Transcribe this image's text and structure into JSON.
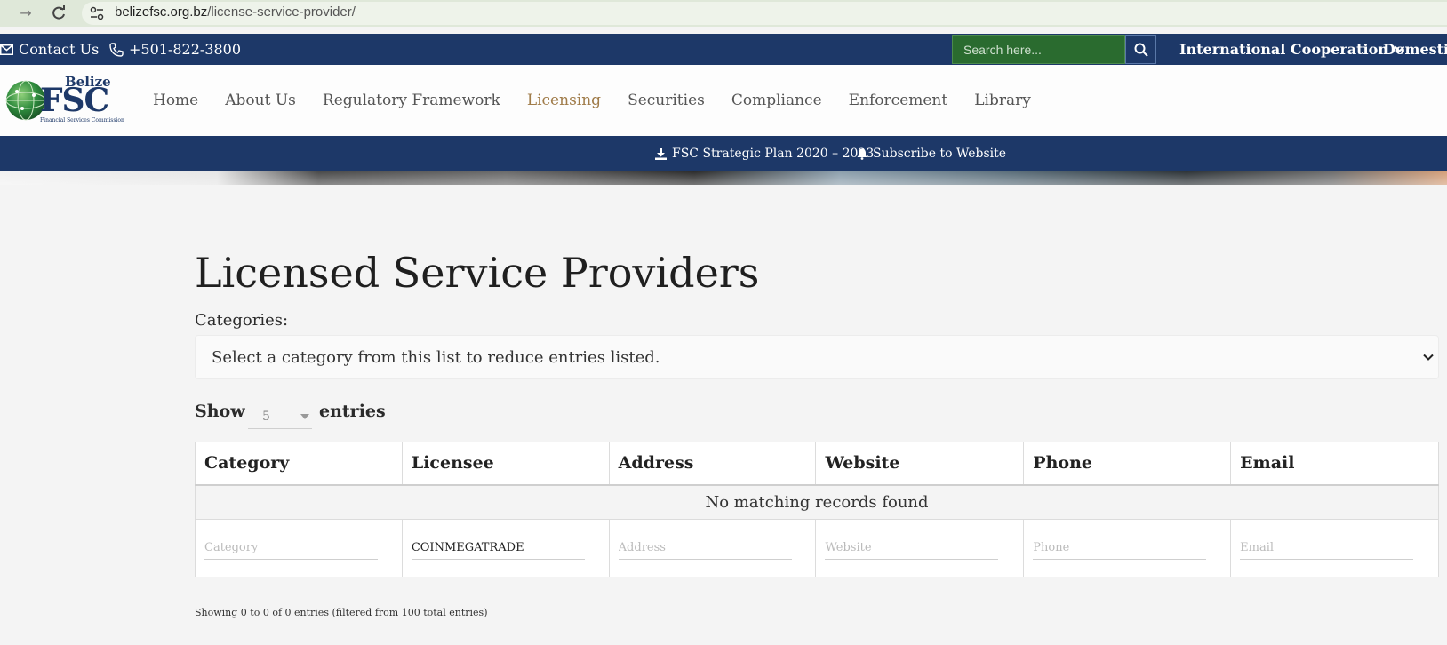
{
  "browser": {
    "url_domain": "belizefsc.org.bz",
    "url_path": "/license-service-provider/"
  },
  "top_bar": {
    "contact_label": "Contact Us",
    "phone_label": "+501-822-3800",
    "search_placeholder": "Search here...",
    "international_label": "International Cooperation",
    "domestic_label": "Domestic C"
  },
  "logo": {
    "top": "Belize",
    "main": "FSC",
    "sub": "Financial Services Commission"
  },
  "nav": {
    "items": [
      "Home",
      "About Us",
      "Regulatory Framework",
      "Licensing",
      "Securities",
      "Compliance",
      "Enforcement",
      "Library"
    ],
    "active": "Licensing"
  },
  "sub_bar": {
    "strategic_plan": "FSC Strategic Plan 2020 – 2023",
    "subscribe": "Subscribe to Website"
  },
  "content": {
    "title": "Licensed Service Providers",
    "categories_label": "Categories:",
    "category_placeholder": "Select a category from this list to reduce entries listed.",
    "show_label": "Show",
    "entries_value": "5",
    "entries_label": "entries"
  },
  "table": {
    "columns": [
      "Category",
      "Licensee",
      "Address",
      "Website",
      "Phone",
      "Email"
    ],
    "empty_message": "No matching records found",
    "filters": {
      "category_placeholder": "Category",
      "licensee_value": "COINMEGATRADE",
      "address_placeholder": "Address",
      "website_placeholder": "Website",
      "phone_placeholder": "Phone",
      "email_placeholder": "Email"
    }
  },
  "footer_info": "Showing 0 to 0 of 0 entries (filtered from 100 total entries)",
  "colors": {
    "navy": "#1d3868",
    "search_green": "#2a6b2f",
    "active_nav": "#a07c4a",
    "background": "#f4f4f4"
  }
}
